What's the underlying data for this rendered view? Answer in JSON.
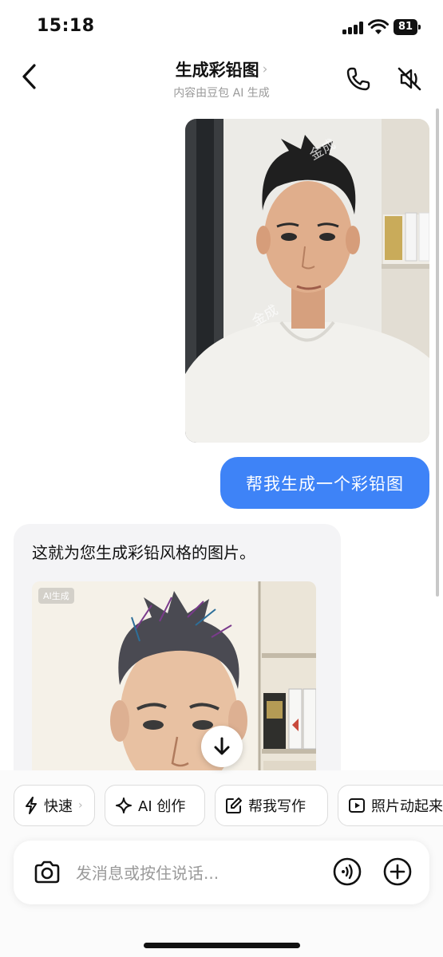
{
  "status_bar": {
    "time": "15:18",
    "battery": "81"
  },
  "header": {
    "title": "生成彩铅图",
    "subtitle": "内容由豆包 AI 生成"
  },
  "messages": {
    "user_photo_watermark": "金成",
    "user_text": "帮我生成一个彩铅图",
    "bot_text": "这就为您生成彩铅风格的图片。",
    "bot_image_badge": "AI生成"
  },
  "chips": [
    {
      "label": "快速",
      "icon": "lightning-icon"
    },
    {
      "label": "AI 创作",
      "icon": "sparkle-icon"
    },
    {
      "label": "帮我写作",
      "icon": "edit-icon"
    },
    {
      "label": "照片动起来",
      "icon": "play-icon"
    }
  ],
  "input": {
    "placeholder": "发消息或按住说话..."
  },
  "colors": {
    "accent_blue": "#3e83f7",
    "bot_bubble": "#f4f4f6"
  }
}
